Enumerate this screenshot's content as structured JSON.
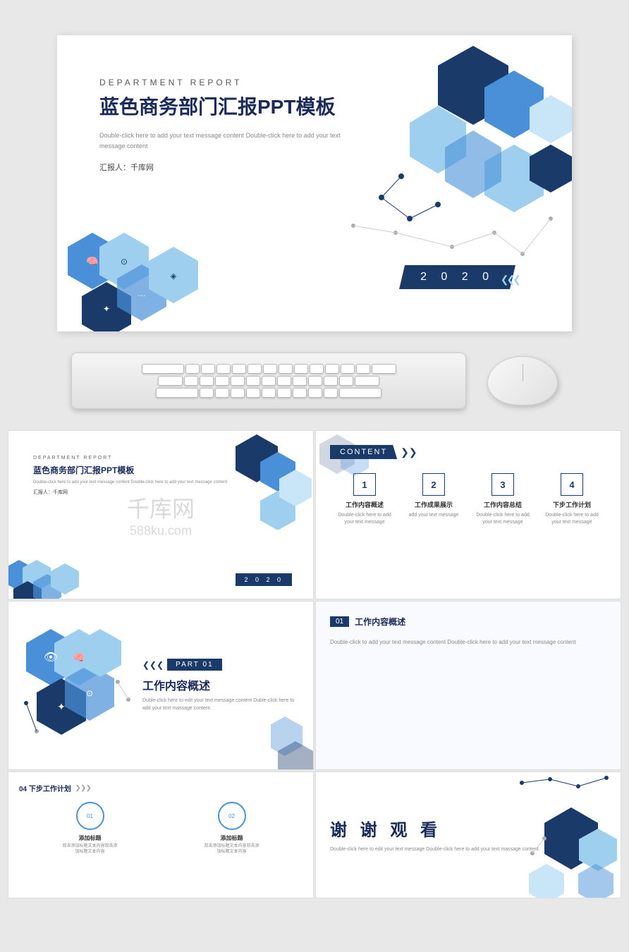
{
  "slide1": {
    "dept_label": "DEPARTMENT  REPORT",
    "title_cn": "蓝色商务部门汇报PPT模板",
    "subtitle": "Double-click here to add your text message content Double-click here to add your text message content",
    "reporter": "汇报人：千库网",
    "year": "2 0 2 0"
  },
  "slide_content": {
    "label": "CONTENT",
    "items": [
      {
        "num": "1",
        "title": "工作内容概述",
        "desc": "Double-click here to add your text message"
      },
      {
        "num": "2",
        "title": "工作成果展示",
        "desc": "add your text message"
      },
      {
        "num": "3",
        "title": "工作内容总结",
        "desc": "Double-click here to add your text message"
      },
      {
        "num": "4",
        "title": "下步工作计划",
        "desc": "Double-click here to add your text message"
      }
    ]
  },
  "slide_part": {
    "part_label": "PART  01",
    "title_cn": "工作内容概述",
    "desc": "Duble-click here to edit your text message content Duble-click here to add your text massage content."
  },
  "slide_work": {
    "num": "01",
    "title": "工作内容概述",
    "desc": "Double-click to add your text message content Double-click here to add your text message content"
  },
  "slide_plan": {
    "title": "04 下步工作计划",
    "items": [
      {
        "title": "添加标题",
        "desc": "双击添加标题文本内容双击添加标题文本内容"
      },
      {
        "title": "添加标题",
        "desc": "双击添加标题文本内容双击添加标题文本内容"
      }
    ]
  },
  "slide_thanks": {
    "title": "谢 谢 观 看",
    "desc": "Double-click here to edit your text message Double-click here to add your text massage content."
  },
  "watermark": {
    "line1": "千库网",
    "line2": "588ku.com"
  },
  "colors": {
    "dark_blue": "#1a3a6a",
    "mid_blue": "#4a90d9",
    "light_blue": "#a8d4f5",
    "hex_dark": "#1a3a6a",
    "hex_mid": "#4a90d9",
    "hex_light": "#9ecfee"
  }
}
